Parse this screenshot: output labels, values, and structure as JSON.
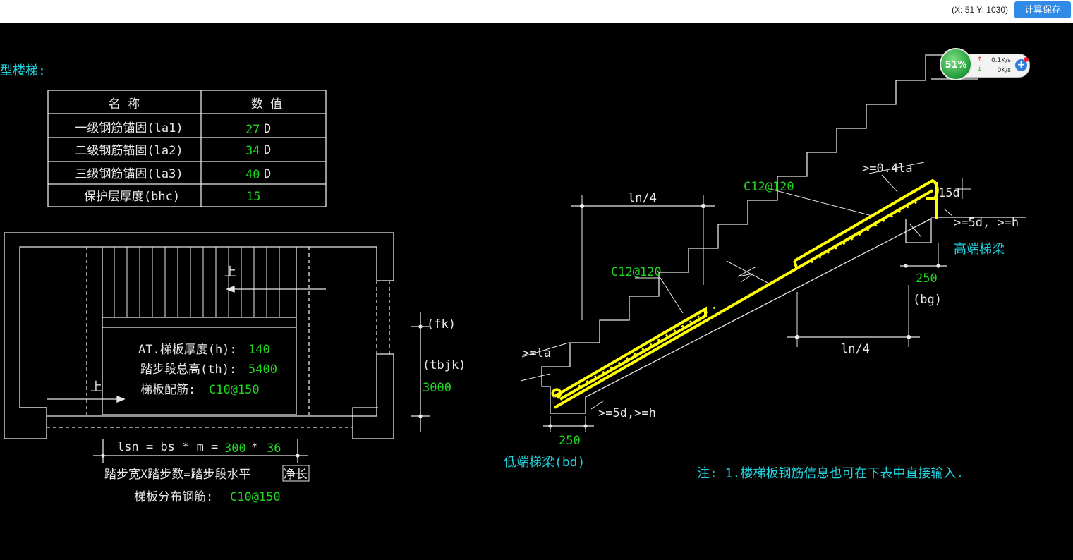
{
  "topbar": {
    "coords": "(X: 51 Y: 1030)",
    "calc_button": "计算保存"
  },
  "widget": {
    "cpu_percent": "51%",
    "upload_rate": "0.1K/s",
    "download_rate": "0K/s",
    "plus": "+"
  },
  "colors": {
    "background": "#000000",
    "line": "#e8e8e8",
    "value": "#1ed81e",
    "heading": "#23d3e0",
    "rebar": "#ffff00"
  },
  "drawing": {
    "heading": "型楼梯:",
    "params_table": {
      "headers": [
        "名  称",
        "数  值"
      ],
      "rows": [
        {
          "name": "一级钢筋锚固(la1)",
          "value": "27",
          "unit": "D"
        },
        {
          "name": "二级钢筋锚固(la2)",
          "value": "34",
          "unit": "D"
        },
        {
          "name": "三级钢筋锚固(la3)",
          "value": "40",
          "unit": "D"
        },
        {
          "name": "保护层厚度(bhc)",
          "value": "15",
          "unit": ""
        }
      ]
    },
    "plan": {
      "up_top": "上",
      "up_bottom": "上",
      "thickness_label": "AT.梯板厚度(h):",
      "thickness_value": "140",
      "height_label": "踏步段总高(th):",
      "height_value": "5400",
      "rebar_label": "梯板配筋:",
      "rebar_value": "C10@150",
      "fk": "(fk)",
      "tbjk": "(tbjk)",
      "width_value": "3000",
      "lsn_formula": "lsn = bs * m =",
      "bs_value": "300",
      "times": "*",
      "m_value": "36",
      "caption_main": "踏步宽X踏步数=踏步段水平",
      "caption_boxed": "净长",
      "dist_label": "梯板分布钢筋:",
      "dist_value": "C10@150"
    },
    "section": {
      "ln4_top": "ln/4",
      "ln4_bottom": "ln/4",
      "rebar_top": "C12@120",
      "rebar_mid": "C12@120",
      "anchor_top": ">=0.4la",
      "hook_15d": "15d",
      "top_5d": ">=5d, >=h",
      "high_beam": "高端梯梁",
      "high_beam_width": "250",
      "bg": "(bg)",
      "la": ">=la",
      "bottom_5d": ">=5d,>=h",
      "low_beam_width": "250",
      "low_beam": "低端梯梁(bd)",
      "note": "注: 1.楼梯板钢筋信息也可在下表中直接输入."
    }
  }
}
